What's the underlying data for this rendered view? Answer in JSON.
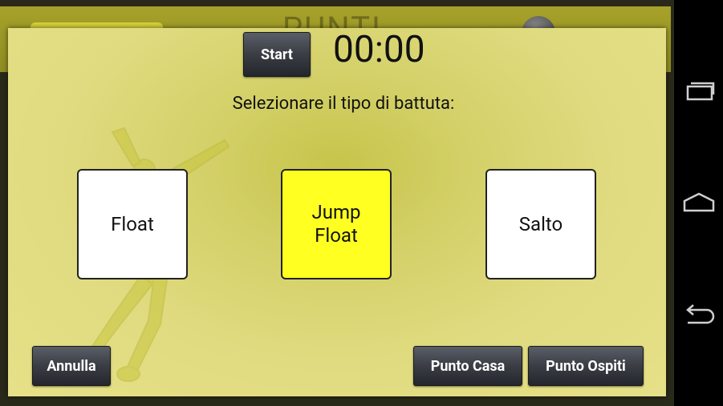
{
  "underlay": {
    "title": "PUNTI"
  },
  "dialog": {
    "start_label": "Start",
    "timer": "00:00",
    "prompt": "Selezionare il tipo di battuta:",
    "choices": [
      {
        "label": "Float",
        "bg": "#ffffff"
      },
      {
        "label": "Jump\nFloat",
        "bg": "#ffff22"
      },
      {
        "label": "Salto",
        "bg": "#ffffff"
      }
    ],
    "cancel_label": "Annulla",
    "home_point_label": "Punto Casa",
    "away_point_label": "Punto Ospiti"
  },
  "navbar": {
    "icons": [
      "recent-apps-icon",
      "home-icon",
      "back-icon"
    ]
  },
  "colors": {
    "dialog_bg": "#e0db80",
    "selected_choice": "#ffff22",
    "button_dark": "#3a3d44"
  }
}
